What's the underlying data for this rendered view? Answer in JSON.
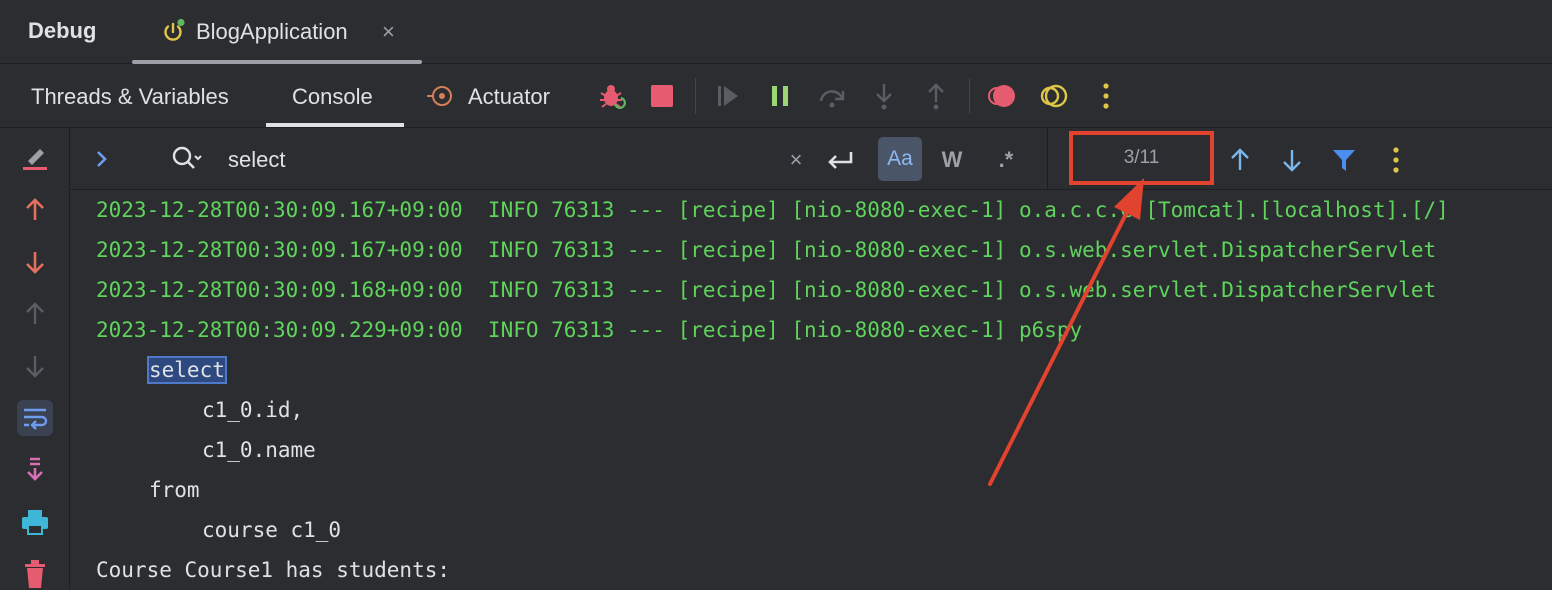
{
  "topbar": {
    "debug_title": "Debug",
    "run_tab_label": "BlogApplication",
    "close_symbol": "×"
  },
  "toolbar": {
    "tabs": [
      {
        "label": "Threads & Variables"
      },
      {
        "label": "Console"
      },
      {
        "label": "Actuator"
      }
    ],
    "active_tab": "Console",
    "icons": [
      "rerun-debug-icon",
      "stop-icon",
      "resume-icon",
      "pause-icon",
      "step-over-icon",
      "step-into-icon",
      "step-out-icon",
      "view-breakpoints-icon",
      "mute-breakpoints-icon",
      "more-icon"
    ]
  },
  "search": {
    "query": "select",
    "clear_symbol": "×",
    "match_case_label": "Aa",
    "words_label": "W",
    "regex_label": ".*",
    "counter": "3/11"
  },
  "console": {
    "lines": [
      "2023-12-28T00:30:09.167+09:00  INFO 76313 --- [recipe] [nio-8080-exec-1] o.a.c.c.C.[Tomcat].[localhost].[/]",
      "2023-12-28T00:30:09.167+09:00  INFO 76313 --- [recipe] [nio-8080-exec-1] o.s.web.servlet.DispatcherServlet",
      "2023-12-28T00:30:09.168+09:00  INFO 76313 --- [recipe] [nio-8080-exec-1] o.s.web.servlet.DispatcherServlet",
      "2023-12-28T00:30:09.229+09:00  INFO 76313 --- [recipe] [nio-8080-exec-1] p6spy"
    ],
    "sql_select": "select",
    "sql_col1": "c1_0.id,",
    "sql_col2": "c1_0.name",
    "sql_from": "from",
    "sql_table": "course c1_0",
    "output": "Course Course1 has students:"
  },
  "colors": {
    "background": "#2b2d30",
    "log_green": "#5fd35b",
    "annotation_red": "#e1432f",
    "match_highlight": "#2d4980"
  }
}
